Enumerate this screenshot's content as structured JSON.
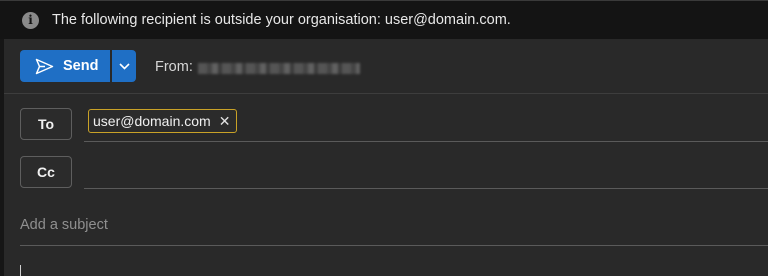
{
  "infobar": {
    "icon": "info-icon",
    "message": "The following recipient is outside your organisation: user@domain.com."
  },
  "toolbar": {
    "send_label": "Send",
    "from_label": "From:"
  },
  "recipients": {
    "to_label": "To",
    "cc_label": "Cc",
    "to_chips": [
      {
        "address": "user@domain.com",
        "remove_icon": "close-icon"
      }
    ]
  },
  "subject": {
    "placeholder": "Add a subject"
  },
  "colors": {
    "accent": "#1f6fc5",
    "chip_border": "#c9a227",
    "background": "#292929"
  }
}
